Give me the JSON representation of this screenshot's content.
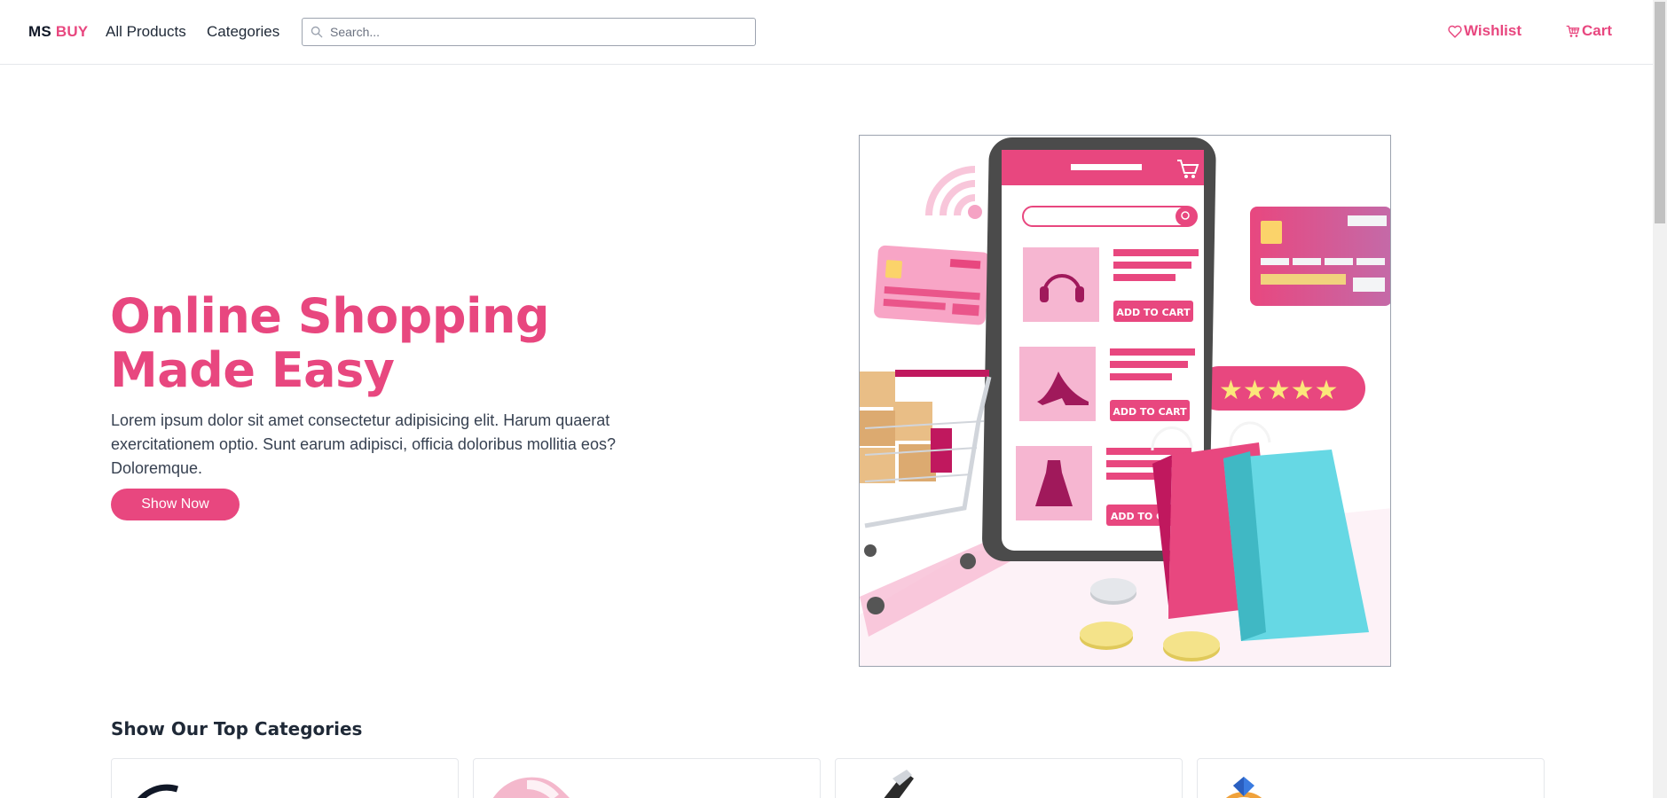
{
  "nav": {
    "brand_part1": "MS",
    "brand_part2": "BUY",
    "links": [
      {
        "label": "All Products"
      },
      {
        "label": "Categories"
      }
    ],
    "search_placeholder": "Search...",
    "wishlist_label": "Wishlist",
    "cart_label": "Cart"
  },
  "hero": {
    "title_line1": "Online Shopping",
    "title_line2": "Made Easy",
    "description": "Lorem ipsum dolor sit amet consectetur adipisicing elit. Harum quaerat exercitationem optio. Sunt earum adipisci, officia doloribus mollitia eos? Doloremque.",
    "button_label": "Show Now",
    "illustration": {
      "button_texts": [
        "ADD TO CART",
        "ADD TO CART",
        "ADD TO CAR"
      ],
      "rating_stars": 5
    }
  },
  "categories": {
    "title": "Show Our Top Categories",
    "cards": [
      {
        "icon": "headphones-icon"
      },
      {
        "icon": "sneaker-icon"
      },
      {
        "icon": "kitchen-tool-icon"
      },
      {
        "icon": "ring-icon"
      }
    ]
  },
  "colors": {
    "accent": "#e8477f",
    "text": "#1f2937",
    "border": "#e5e7eb"
  }
}
